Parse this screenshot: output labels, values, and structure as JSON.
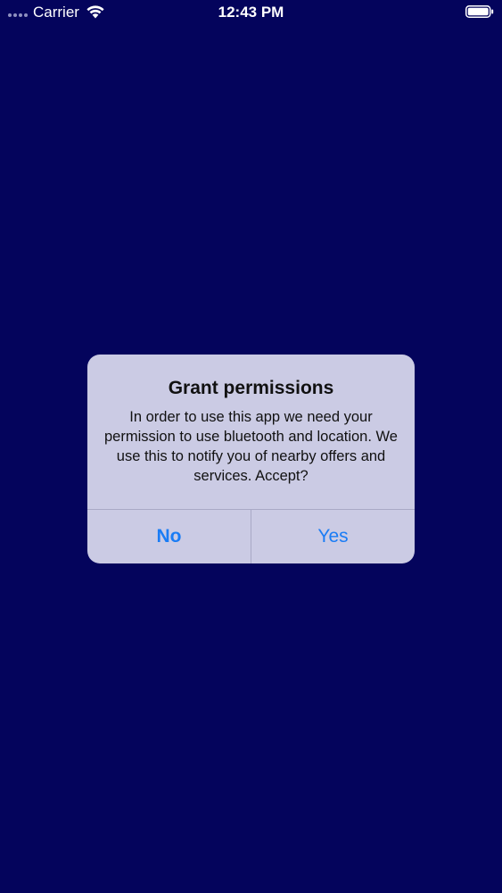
{
  "status_bar": {
    "carrier": "Carrier",
    "time": "12:43 PM"
  },
  "dialog": {
    "title": "Grant permissions",
    "message": "In order to use this app we need your permission to use bluetooth and location. We use this to notify you of nearby offers and services. Accept?",
    "buttons": {
      "no_label": "No",
      "yes_label": "Yes"
    }
  },
  "colors": {
    "background": "#04045c",
    "dialog_background": "#cbcbe4",
    "button_text": "#1a7cf5"
  }
}
